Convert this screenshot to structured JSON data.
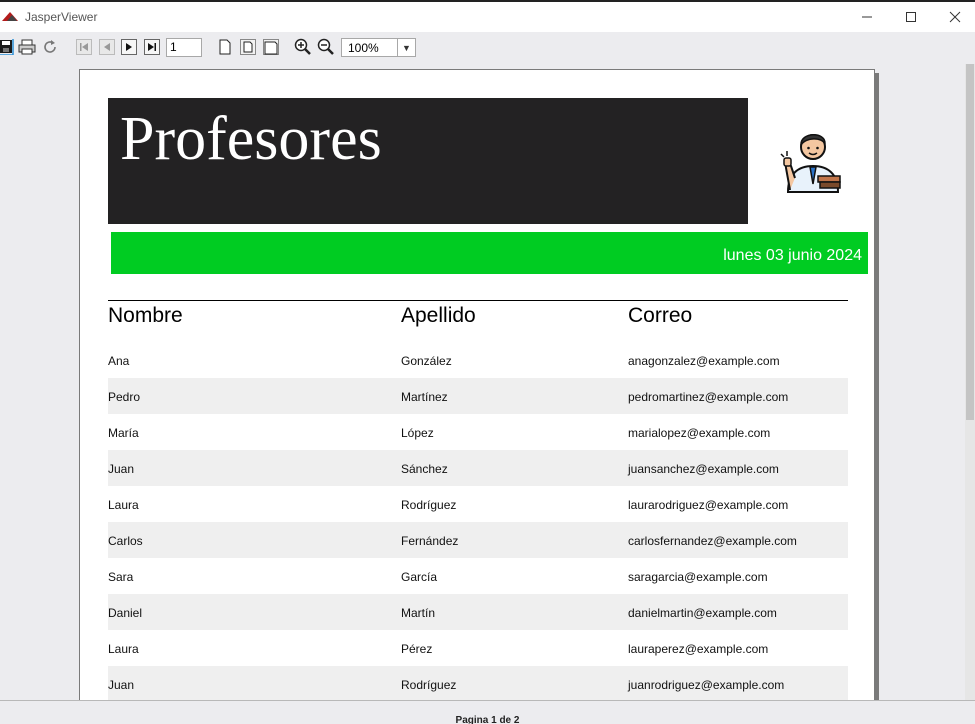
{
  "window": {
    "title": "JasperViewer"
  },
  "toolbar": {
    "page_number": "1",
    "zoom": "100%"
  },
  "report": {
    "title": "Profesores",
    "date": "lunes 03 junio 2024",
    "columns": {
      "nombre": "Nombre",
      "apellido": "Apellido",
      "correo": "Correo"
    },
    "rows": [
      {
        "nombre": "Ana",
        "apellido": "González",
        "correo": "anagonzalez@example.com"
      },
      {
        "nombre": "Pedro",
        "apellido": "Martínez",
        "correo": "pedromartinez@example.com"
      },
      {
        "nombre": "María",
        "apellido": "López",
        "correo": "marialopez@example.com"
      },
      {
        "nombre": "Juan",
        "apellido": "Sánchez",
        "correo": "juansanchez@example.com"
      },
      {
        "nombre": "Laura",
        "apellido": "Rodríguez",
        "correo": "laurarodriguez@example.com"
      },
      {
        "nombre": "Carlos",
        "apellido": "Fernández",
        "correo": "carlosfernandez@example.com"
      },
      {
        "nombre": "Sara",
        "apellido": "García",
        "correo": "saragarcia@example.com"
      },
      {
        "nombre": "Daniel",
        "apellido": "Martín",
        "correo": "danielmartin@example.com"
      },
      {
        "nombre": "Laura",
        "apellido": "Pérez",
        "correo": "lauraperez@example.com"
      },
      {
        "nombre": "Juan",
        "apellido": "Rodríguez",
        "correo": "juanrodriguez@example.com"
      }
    ]
  },
  "status": {
    "page_info": "Pagina 1 de 2"
  },
  "colors": {
    "header_bg": "#232223",
    "date_bar": "#00cc22",
    "row_alt": "#efefef"
  },
  "icons": [
    "jasper-logo-icon",
    "save-icon",
    "print-icon",
    "reload-icon",
    "first-page-icon",
    "previous-page-icon",
    "next-page-icon",
    "last-page-icon",
    "actual-size-icon",
    "fit-page-icon",
    "fit-width-icon",
    "zoom-in-icon",
    "zoom-out-icon",
    "chevron-down-icon",
    "teacher-avatar"
  ]
}
